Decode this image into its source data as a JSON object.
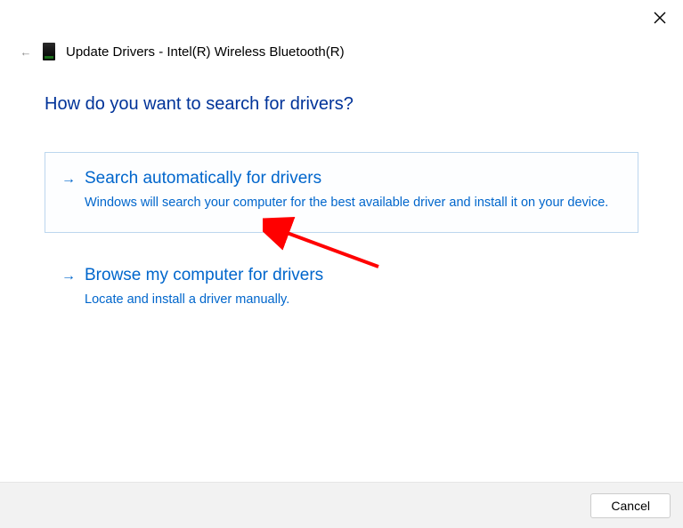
{
  "window": {
    "title": "Update Drivers - Intel(R) Wireless Bluetooth(R)"
  },
  "heading": "How do you want to search for drivers?",
  "options": {
    "auto": {
      "title": "Search automatically for drivers",
      "desc": "Windows will search your computer for the best available driver and install it on your device."
    },
    "browse": {
      "title": "Browse my computer for drivers",
      "desc": "Locate and install a driver manually."
    }
  },
  "buttons": {
    "cancel": "Cancel"
  },
  "colors": {
    "link": "#0066cc",
    "heading": "#003399",
    "arrow": "#ff0000"
  }
}
